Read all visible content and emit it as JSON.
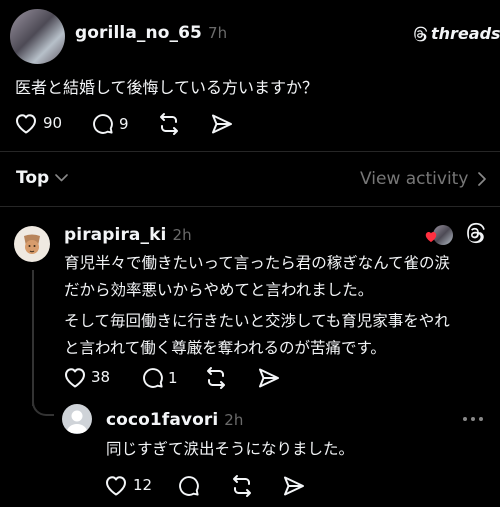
{
  "post": {
    "username": "gorilla_no_65",
    "time": "7h",
    "brand": "threads",
    "text": "医者と結婚して後悔している方いますか？",
    "likes": "90",
    "replies": "9"
  },
  "sort": {
    "label": "Top",
    "view_activity": "View activity"
  },
  "reply1": {
    "username": "pirapira_ki",
    "time": "2h",
    "lines": [
      "育児半々で働きたいって言ったら君の稼ぎなんて雀の涙",
      "だから効率悪いからやめてと言われました。",
      "そして毎回働きに行きたいと交渉しても育児家事をやれ",
      "と言われて働く尊厳を奪われるのが苦痛です。"
    ],
    "likes": "38",
    "replies": "1"
  },
  "reply2": {
    "username": "coco1favori",
    "time": "2h",
    "text": "同じすぎて涙出そうになりました。",
    "likes": "12"
  },
  "colors": {
    "background": "#000000",
    "text": "#f3f5f7",
    "muted": "#777777",
    "heart": "#ff3040"
  }
}
